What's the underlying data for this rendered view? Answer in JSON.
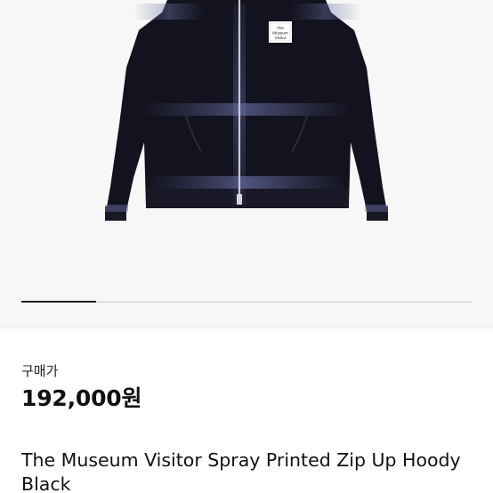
{
  "product": {
    "image_alt": "The Museum Visitor Spray Printed Zip Up Hoody Black",
    "patch_text": [
      "The",
      "Museum",
      "Visitor"
    ],
    "price_label": "구매가",
    "price": "192,000원",
    "title": "The Museum Visitor Spray Printed Zip Up Hoody Black"
  },
  "gallery": {
    "current_index": 1,
    "total": 6
  },
  "colors": {
    "background": "#f7f7f7",
    "garment": "#13131f",
    "spray": "#5a5f8e",
    "text": "#111111"
  }
}
